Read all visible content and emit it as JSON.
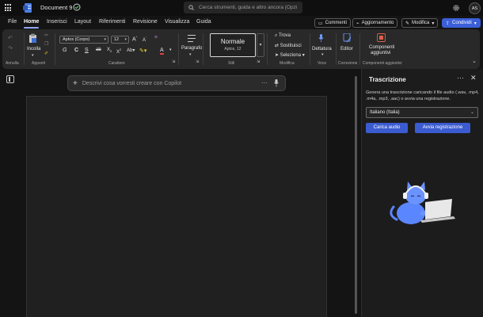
{
  "app": {
    "document_title": "Document 9",
    "search_placeholder": "Cerca strumenti, guida e altro ancora (Opzi",
    "user_initials": "AS"
  },
  "menu": {
    "tabs": [
      "File",
      "Home",
      "Inserisci",
      "Layout",
      "Riferimenti",
      "Revisione",
      "Visualizza",
      "Guida"
    ],
    "active_tab": "Home",
    "comments_label": "Commenti",
    "update_label": "Aggiornamento",
    "edit_label": "Modifica",
    "share_label": "Condividi"
  },
  "ribbon": {
    "undo_group_label": "Annulla",
    "paste_label": "Incolla",
    "clipboard_group_label": "Appunti",
    "font_name": "Aptos (Corpo)",
    "font_size": "12",
    "font_group_label": "Carattere",
    "paragraph_label": "Paragrafo",
    "style_name": "Normale",
    "style_font": "Aptos, 12",
    "styles_group_label": "Stili",
    "find_label": "Trova",
    "replace_label": "Sostituisci",
    "select_label": "Seleziona",
    "edit_group_label": "Modifica",
    "dictate_label": "Dettatura",
    "voice_group_label": "Voce",
    "editor_label": "Editor",
    "proofing_group_label": "Correzione",
    "addins_label_1": "Componenti",
    "addins_label_2": "aggiuntivi",
    "addins_group_label": "Componenti aggiuntivi"
  },
  "copilot": {
    "placeholder": "Descrivi cosa vorresti creare con Copilot"
  },
  "pane": {
    "title": "Trascrizione",
    "description": "Genera una trascrizione caricando il file audio (.wav, .mp4, .m4a, .mp3, .aac) o avvia una registrazione.",
    "language": "Italiano (Italia)",
    "upload_label": "Carica audio",
    "record_label": "Avvia registrazione"
  },
  "colors": {
    "accent": "#3b5fd9",
    "background": "#141414",
    "ribbon": "#292929",
    "page": "#202020"
  }
}
